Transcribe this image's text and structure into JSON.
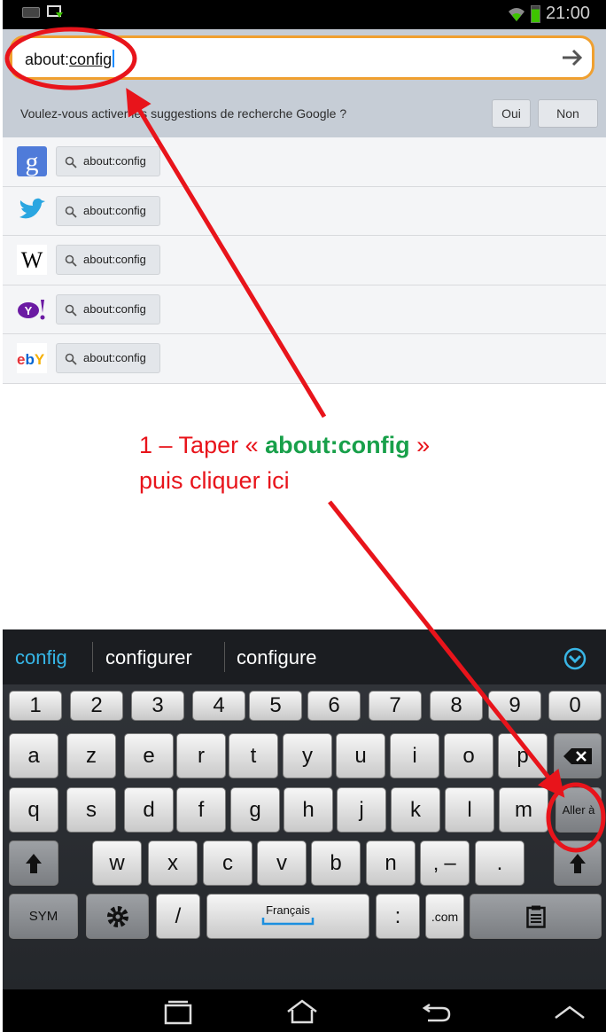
{
  "status_bar": {
    "time": "21:00"
  },
  "url_bar": {
    "text_prefix": "about:",
    "text_underlined": "config"
  },
  "search_prompt": {
    "text": "Voulez-vous activer les suggestions de recherche Google ?",
    "yes_label": "Oui",
    "no_label": "Non"
  },
  "engines": [
    {
      "engine": "google-icon",
      "query": "about:config"
    },
    {
      "engine": "twitter-icon",
      "query": "about:config"
    },
    {
      "engine": "wikipedia-icon",
      "query": "about:config"
    },
    {
      "engine": "yahoo-icon",
      "query": "about:config"
    },
    {
      "engine": "ebay-icon",
      "query": "about:config"
    }
  ],
  "annotation": {
    "line1_prefix": "1 – Taper « ",
    "command": "about:config",
    "line1_suffix": " »",
    "line2": "puis cliquer ici",
    "color": "#e8141b",
    "command_color": "#18a04a"
  },
  "suggestions": [
    "config",
    "configurer",
    "configure"
  ],
  "keyboard": {
    "row1": [
      "1",
      "2",
      "3",
      "4",
      "5",
      "6",
      "7",
      "8",
      "9",
      "0"
    ],
    "row2": [
      "a",
      "z",
      "e",
      "r",
      "t",
      "y",
      "u",
      "i",
      "o",
      "p"
    ],
    "row3": [
      "q",
      "s",
      "d",
      "f",
      "g",
      "h",
      "j",
      "k",
      "l",
      "m"
    ],
    "row3_action": "Aller à",
    "row4": [
      "w",
      "x",
      "c",
      "v",
      "b",
      "n"
    ],
    "row4_punct": [
      "‚ –",
      "."
    ],
    "sym_label": "SYM",
    "slash_label": "/",
    "space_label": "Français",
    "colon_label": ":",
    "dotcom_label": ".com"
  }
}
